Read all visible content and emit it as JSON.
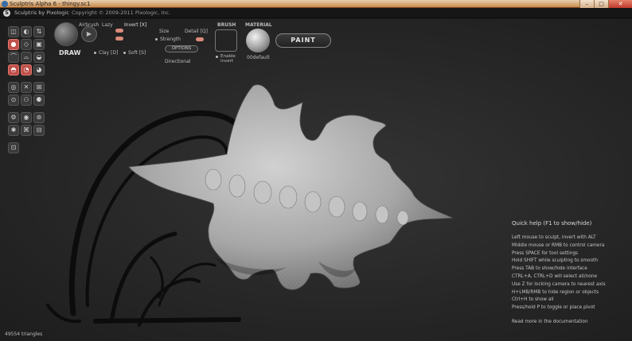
{
  "window": {
    "title": "Sculptris Alpha 6 - thingy.sc1",
    "minimize": "–",
    "maximize": "□",
    "close": "✕"
  },
  "header": {
    "logo": "S",
    "brand": "Sculptris by Pixologic",
    "copyright": "Copyright © 2009-2011 Pixologic, Inc."
  },
  "tools": {
    "rows": [
      [
        "◫",
        "◐",
        "⇅"
      ],
      [
        "●",
        "◇",
        "▣"
      ],
      [
        "⌒",
        "⌓",
        "◒"
      ],
      [
        "◓",
        "◔",
        "◕"
      ],
      [],
      [
        "◎",
        "✕",
        "⊞"
      ],
      [
        "⊙",
        "⚇",
        "⚈"
      ],
      [],
      [
        "⚙",
        "◉",
        "⊛"
      ],
      [
        "✱",
        "⌘",
        "⊟"
      ],
      [],
      [
        "⊡"
      ]
    ],
    "icon_names": [
      "symmetry",
      "rotate",
      "flip",
      "draw",
      "crease",
      "flatten",
      "inflate",
      "pinch",
      "smooth",
      "grab",
      "scale",
      "reduce",
      "mask",
      "wire",
      "grid",
      "scene",
      "camera",
      "light",
      "settings",
      "sphere",
      "target",
      "star",
      "link",
      "panel",
      "image"
    ]
  },
  "brush": {
    "mode": "DRAW",
    "airbrush": "Airbrush",
    "lazy": "Lazy",
    "invert": "Invert [X]",
    "size": "Size",
    "strength": "Strength",
    "detail": "Detail [Q]",
    "options": "OPTIONS",
    "directional": "Directional",
    "clay": "Clay [D]",
    "soft": "Soft [S]",
    "brush_title": "BRUSH",
    "enable_invert": "Enable\ninvert",
    "material_title": "MATERIAL",
    "material_name": "00default",
    "paint": "PAINT"
  },
  "help": {
    "title": "Quick help (F1 to show/hide)",
    "lines": [
      "Left mouse to sculpt, invert with ALT",
      "Middle mouse or RMB to control camera",
      "Press SPACE for tool settings",
      "Hold SHIFT while sculpting to smooth",
      "Press TAB to show/hide interface",
      "CTRL+A, CTRL+D will select all/none",
      "Use Z for locking camera to nearest axis",
      "H+LMB/RMB to hide region or objects",
      "Ctrl+H to show all",
      "Press/hold P to toggle or place pivot"
    ],
    "more": "Read more in the documentation"
  },
  "status": {
    "triangles": "49554 triangles"
  },
  "colors": {
    "accent": "#c0504a",
    "slider": "#d98a7a",
    "model": "#b4b4b4",
    "background": "#2a2a2a"
  }
}
